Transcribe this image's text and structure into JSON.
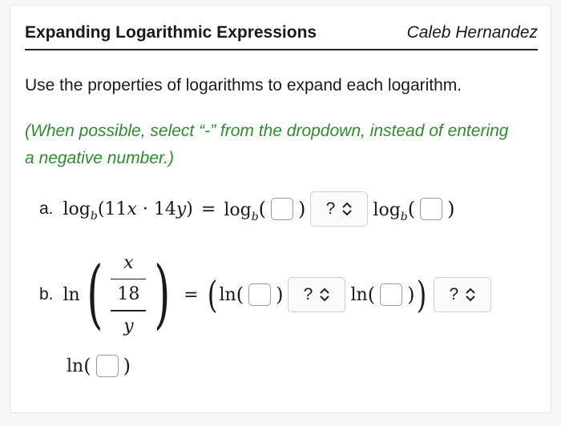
{
  "header": {
    "title": "Expanding Logarithmic Expressions",
    "author": "Caleb Hernandez"
  },
  "instruction": "Use the properties of logarithms to expand each logarithm.",
  "note": "(When possible, select “-” from the dropdown, instead of entering a negative number.)",
  "dropdown_placeholder": "?",
  "part_a": {
    "label": "a.",
    "log": "log",
    "base": "b",
    "expr": "(11",
    "x": "x",
    "dot": " · 14",
    "y": "y",
    "close": ")",
    "equals": "=",
    "open_paren": "(",
    "close_paren": ")"
  },
  "part_b": {
    "label": "b.",
    "ln": "ln",
    "frac_x": "x",
    "frac_num": "18",
    "frac_y": "y",
    "equals": "=",
    "open_paren": "(",
    "close_paren": ")"
  }
}
